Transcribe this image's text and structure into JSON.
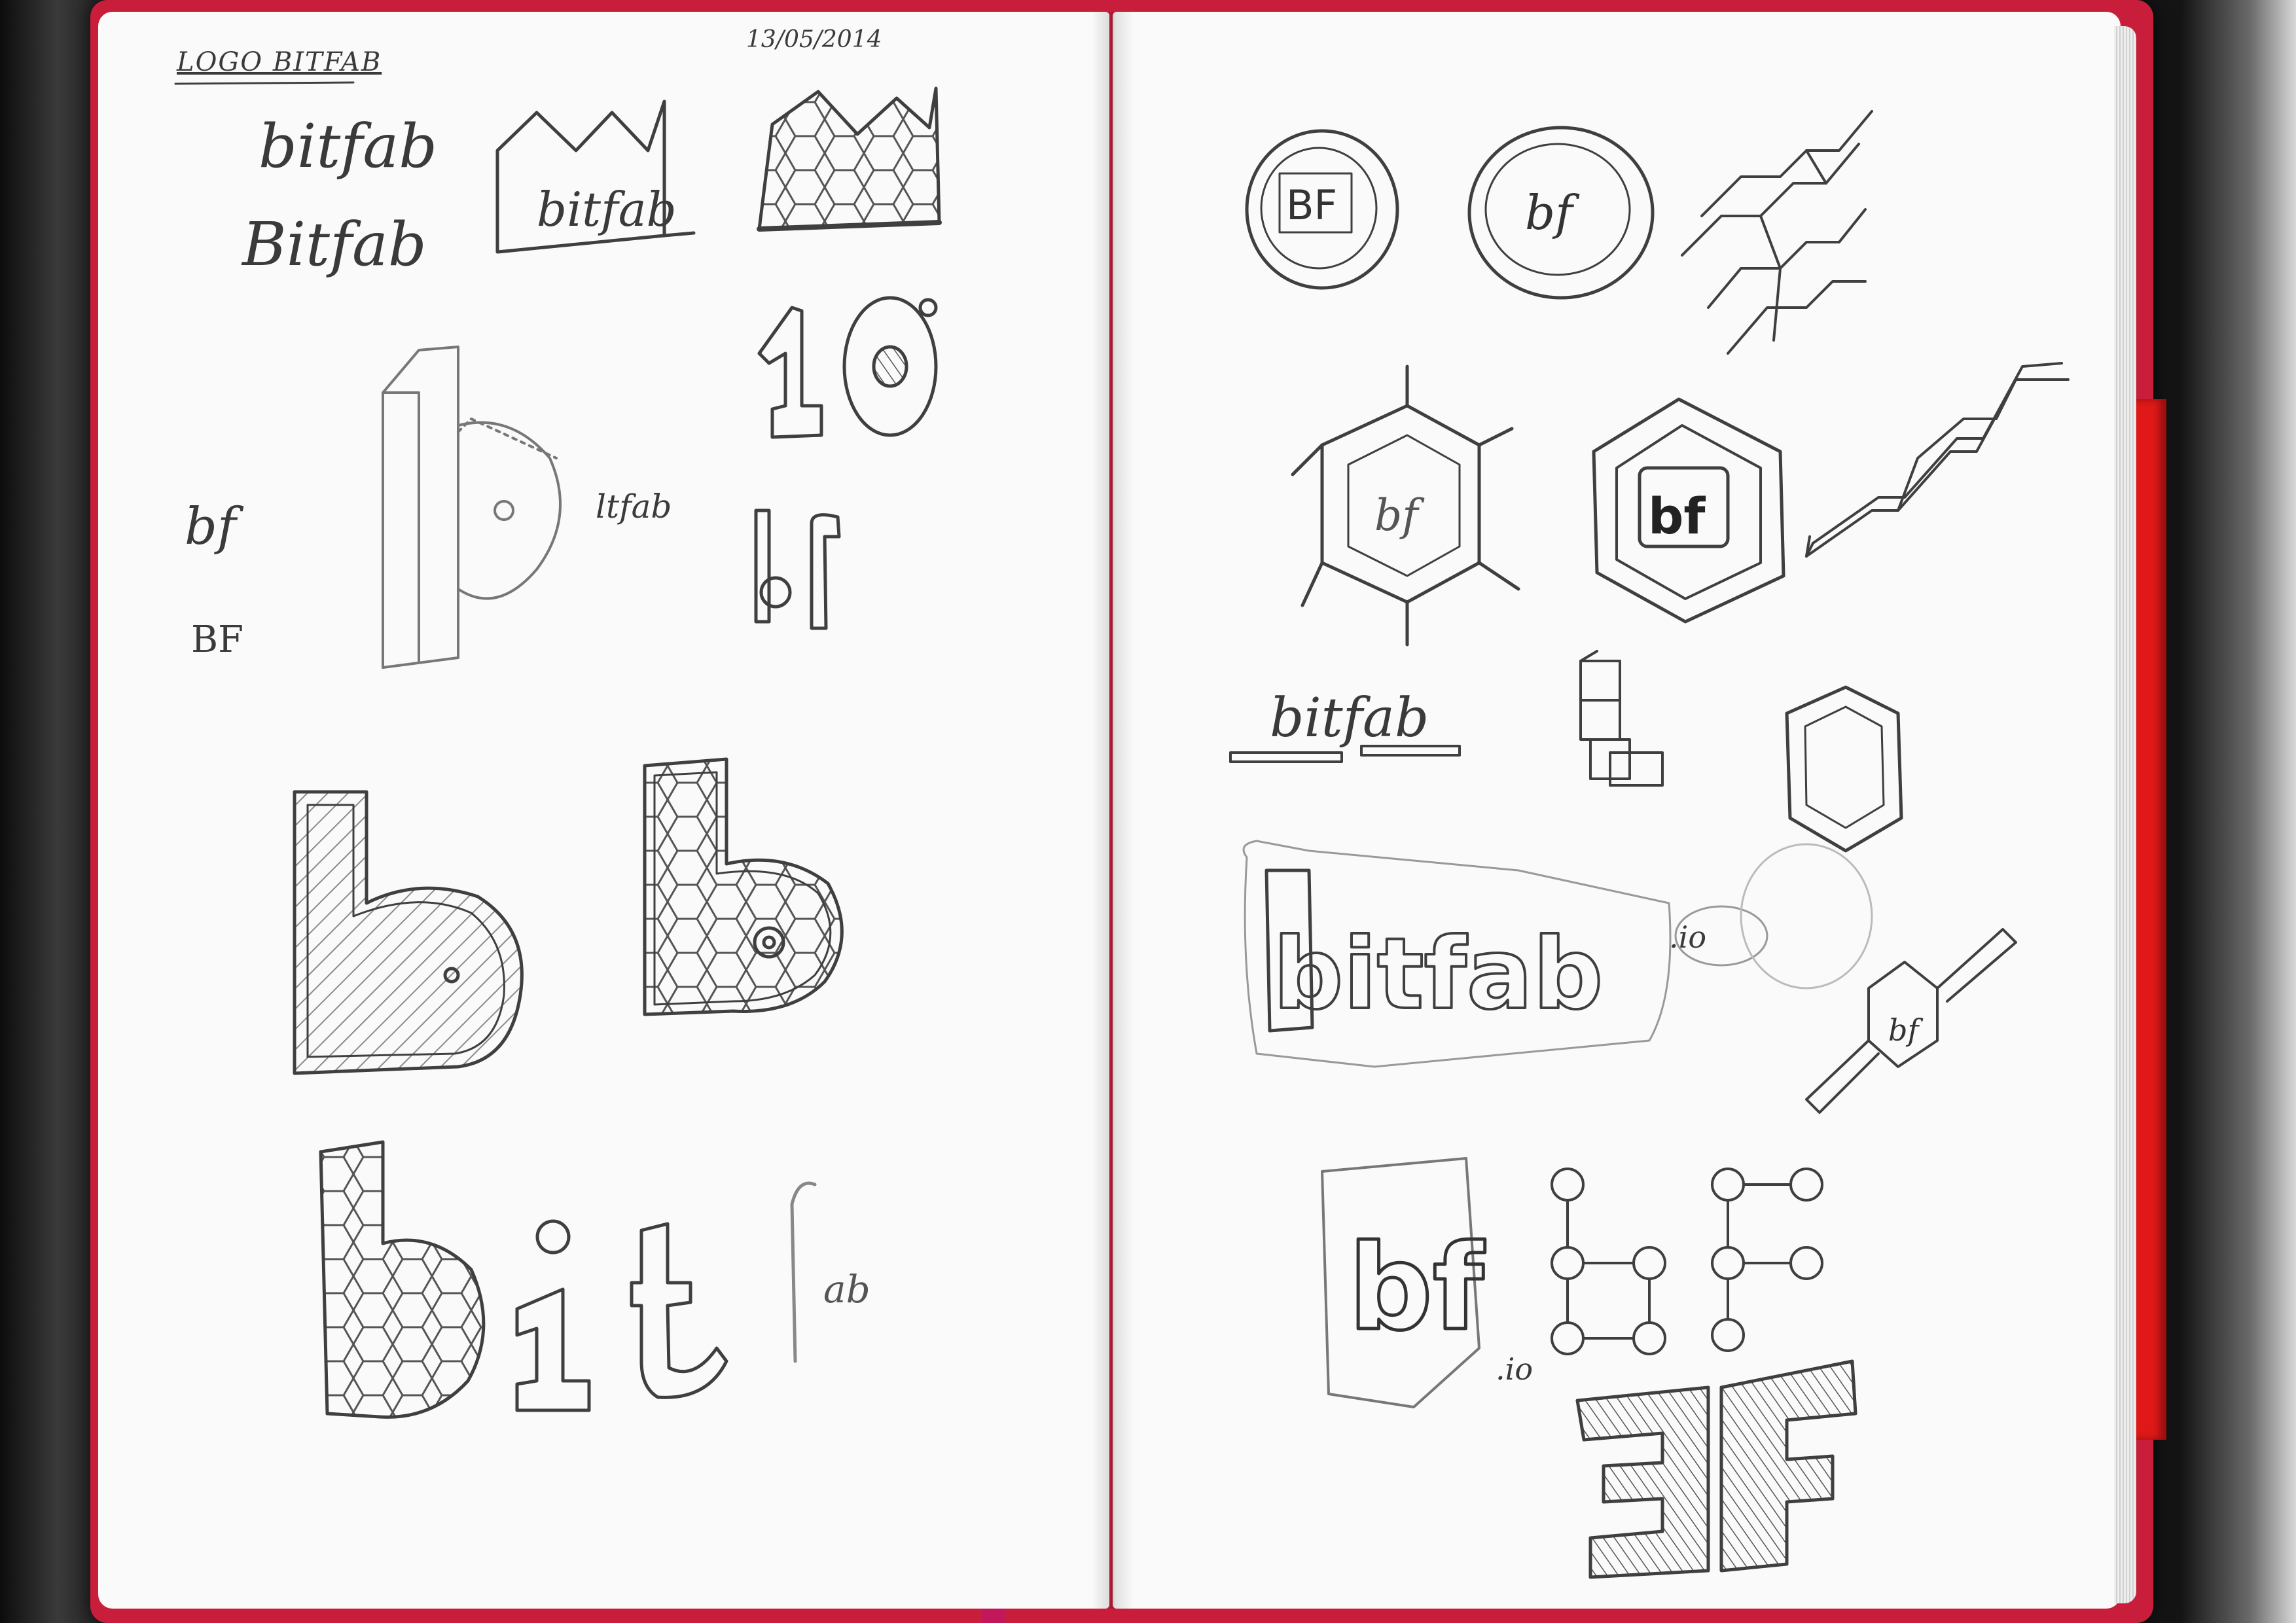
{
  "image": {
    "subject": "sketchbook-spread",
    "colors": {
      "background": "#141414",
      "cover": "#c81e3c",
      "bookmark_band": "#e01818",
      "paper": "#fafafa",
      "pencil": "#3a3a3a",
      "ribbon": "#c2185b"
    }
  },
  "handwriting": {
    "title": "LOGO BITFAB",
    "date": "13/05/2014",
    "wordmark_1": "bitfab",
    "wordmark_2": "Bitfab",
    "bf_lower": "bf",
    "bf_upper": "BF",
    "small_label": "ltfab",
    "underlined_wordmark": "bitfab",
    "dot_io_1": ".io",
    "dot_io_2": ".io"
  },
  "sketch_text": {
    "box_wordmark": "bitfab",
    "ten": "10",
    "stacked_bf": "bf",
    "circle_logo_1": "BF",
    "circle_logo_2": "bf",
    "hex_logo_1": "bf",
    "hex_logo_2": "bf",
    "bubble_wordmark": "bitfab",
    "diamond_logo": "bf",
    "block_logo": "bf",
    "big_bf": "3F",
    "large_letters": [
      "b",
      "i",
      "t",
      "f",
      "a",
      "b"
    ]
  }
}
